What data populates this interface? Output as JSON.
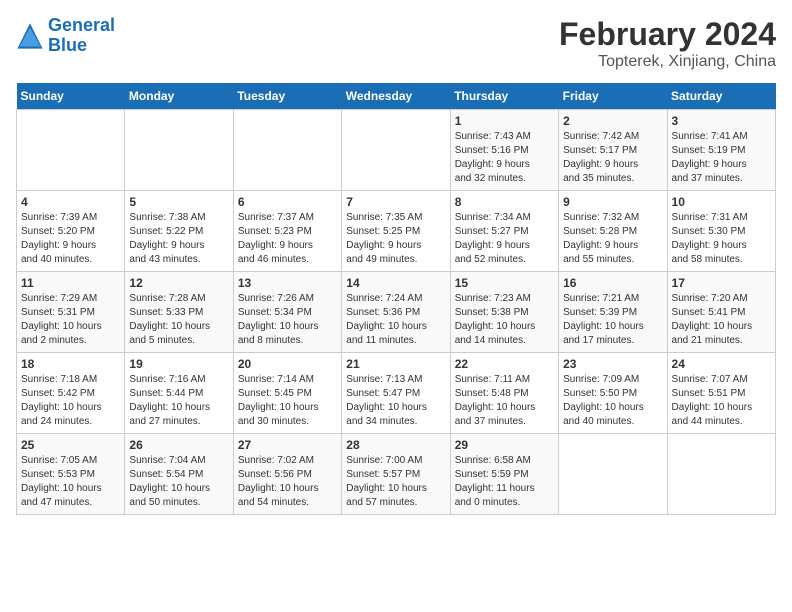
{
  "logo": {
    "text_general": "General",
    "text_blue": "Blue"
  },
  "header": {
    "title": "February 2024",
    "subtitle": "Topterek, Xinjiang, China"
  },
  "weekdays": [
    "Sunday",
    "Monday",
    "Tuesday",
    "Wednesday",
    "Thursday",
    "Friday",
    "Saturday"
  ],
  "weeks": [
    [
      {
        "day": "",
        "info": ""
      },
      {
        "day": "",
        "info": ""
      },
      {
        "day": "",
        "info": ""
      },
      {
        "day": "",
        "info": ""
      },
      {
        "day": "1",
        "info": "Sunrise: 7:43 AM\nSunset: 5:16 PM\nDaylight: 9 hours\nand 32 minutes."
      },
      {
        "day": "2",
        "info": "Sunrise: 7:42 AM\nSunset: 5:17 PM\nDaylight: 9 hours\nand 35 minutes."
      },
      {
        "day": "3",
        "info": "Sunrise: 7:41 AM\nSunset: 5:19 PM\nDaylight: 9 hours\nand 37 minutes."
      }
    ],
    [
      {
        "day": "4",
        "info": "Sunrise: 7:39 AM\nSunset: 5:20 PM\nDaylight: 9 hours\nand 40 minutes."
      },
      {
        "day": "5",
        "info": "Sunrise: 7:38 AM\nSunset: 5:22 PM\nDaylight: 9 hours\nand 43 minutes."
      },
      {
        "day": "6",
        "info": "Sunrise: 7:37 AM\nSunset: 5:23 PM\nDaylight: 9 hours\nand 46 minutes."
      },
      {
        "day": "7",
        "info": "Sunrise: 7:35 AM\nSunset: 5:25 PM\nDaylight: 9 hours\nand 49 minutes."
      },
      {
        "day": "8",
        "info": "Sunrise: 7:34 AM\nSunset: 5:27 PM\nDaylight: 9 hours\nand 52 minutes."
      },
      {
        "day": "9",
        "info": "Sunrise: 7:32 AM\nSunset: 5:28 PM\nDaylight: 9 hours\nand 55 minutes."
      },
      {
        "day": "10",
        "info": "Sunrise: 7:31 AM\nSunset: 5:30 PM\nDaylight: 9 hours\nand 58 minutes."
      }
    ],
    [
      {
        "day": "11",
        "info": "Sunrise: 7:29 AM\nSunset: 5:31 PM\nDaylight: 10 hours\nand 2 minutes."
      },
      {
        "day": "12",
        "info": "Sunrise: 7:28 AM\nSunset: 5:33 PM\nDaylight: 10 hours\nand 5 minutes."
      },
      {
        "day": "13",
        "info": "Sunrise: 7:26 AM\nSunset: 5:34 PM\nDaylight: 10 hours\nand 8 minutes."
      },
      {
        "day": "14",
        "info": "Sunrise: 7:24 AM\nSunset: 5:36 PM\nDaylight: 10 hours\nand 11 minutes."
      },
      {
        "day": "15",
        "info": "Sunrise: 7:23 AM\nSunset: 5:38 PM\nDaylight: 10 hours\nand 14 minutes."
      },
      {
        "day": "16",
        "info": "Sunrise: 7:21 AM\nSunset: 5:39 PM\nDaylight: 10 hours\nand 17 minutes."
      },
      {
        "day": "17",
        "info": "Sunrise: 7:20 AM\nSunset: 5:41 PM\nDaylight: 10 hours\nand 21 minutes."
      }
    ],
    [
      {
        "day": "18",
        "info": "Sunrise: 7:18 AM\nSunset: 5:42 PM\nDaylight: 10 hours\nand 24 minutes."
      },
      {
        "day": "19",
        "info": "Sunrise: 7:16 AM\nSunset: 5:44 PM\nDaylight: 10 hours\nand 27 minutes."
      },
      {
        "day": "20",
        "info": "Sunrise: 7:14 AM\nSunset: 5:45 PM\nDaylight: 10 hours\nand 30 minutes."
      },
      {
        "day": "21",
        "info": "Sunrise: 7:13 AM\nSunset: 5:47 PM\nDaylight: 10 hours\nand 34 minutes."
      },
      {
        "day": "22",
        "info": "Sunrise: 7:11 AM\nSunset: 5:48 PM\nDaylight: 10 hours\nand 37 minutes."
      },
      {
        "day": "23",
        "info": "Sunrise: 7:09 AM\nSunset: 5:50 PM\nDaylight: 10 hours\nand 40 minutes."
      },
      {
        "day": "24",
        "info": "Sunrise: 7:07 AM\nSunset: 5:51 PM\nDaylight: 10 hours\nand 44 minutes."
      }
    ],
    [
      {
        "day": "25",
        "info": "Sunrise: 7:05 AM\nSunset: 5:53 PM\nDaylight: 10 hours\nand 47 minutes."
      },
      {
        "day": "26",
        "info": "Sunrise: 7:04 AM\nSunset: 5:54 PM\nDaylight: 10 hours\nand 50 minutes."
      },
      {
        "day": "27",
        "info": "Sunrise: 7:02 AM\nSunset: 5:56 PM\nDaylight: 10 hours\nand 54 minutes."
      },
      {
        "day": "28",
        "info": "Sunrise: 7:00 AM\nSunset: 5:57 PM\nDaylight: 10 hours\nand 57 minutes."
      },
      {
        "day": "29",
        "info": "Sunrise: 6:58 AM\nSunset: 5:59 PM\nDaylight: 11 hours\nand 0 minutes."
      },
      {
        "day": "",
        "info": ""
      },
      {
        "day": "",
        "info": ""
      }
    ]
  ]
}
